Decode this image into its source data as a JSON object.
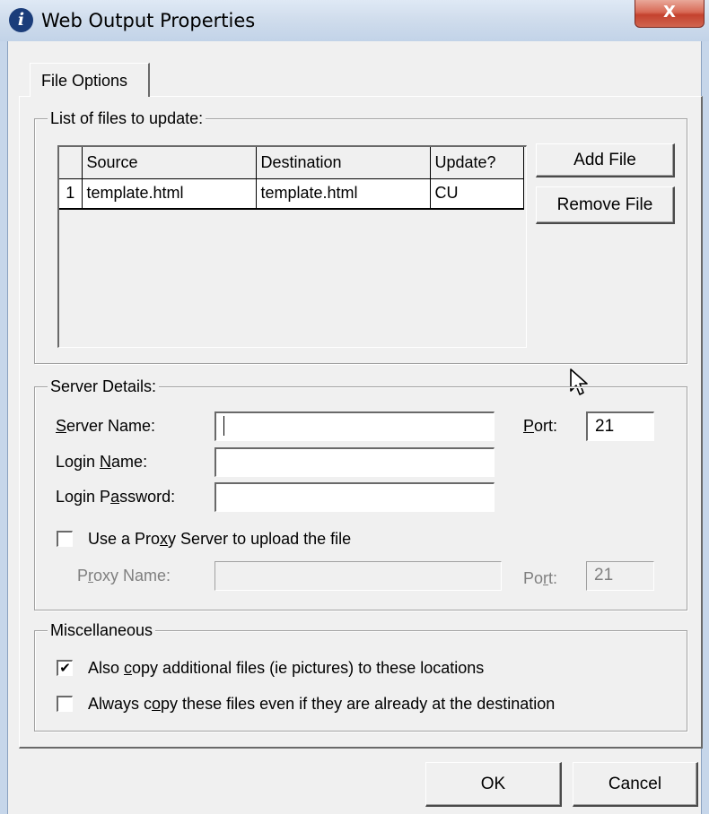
{
  "window": {
    "title": "Web Output Properties",
    "icon": "info-icon",
    "close_glyph": "X"
  },
  "tabs": [
    {
      "label": "File Options",
      "selected": true
    }
  ],
  "files_group": {
    "label": "List of files to update:",
    "columns": [
      "Source",
      "Destination",
      "Update?"
    ],
    "rows": [
      {
        "num": "1",
        "source": "template.html",
        "destination": "template.html",
        "update": "CU"
      }
    ],
    "add_button": "Add File",
    "remove_button": "Remove File"
  },
  "server_group": {
    "label": "Server Details:",
    "server_name": {
      "label_pre": "",
      "label_u": "S",
      "label_post": "erver Name:",
      "value": ""
    },
    "login_name": {
      "label_pre": "Login ",
      "label_u": "N",
      "label_post": "ame:",
      "value": ""
    },
    "login_password": {
      "label_pre": "Login P",
      "label_u": "a",
      "label_post": "ssword:",
      "value": ""
    },
    "port": {
      "label_pre": "",
      "label_u": "P",
      "label_post": "ort:",
      "value": "21"
    },
    "use_proxy": {
      "label_pre": "Use a Pro",
      "label_u": "x",
      "label_post": "y Server to upload the file",
      "checked": false
    },
    "proxy_name": {
      "label_pre": "P",
      "label_u": "r",
      "label_post": "oxy Name:",
      "value": ""
    },
    "proxy_port": {
      "label_pre": "Po",
      "label_u": "r",
      "label_post": "t:",
      "value": "21"
    }
  },
  "misc_group": {
    "label": "Miscellaneous",
    "copy_additional": {
      "label_pre": "Also ",
      "label_u": "c",
      "label_post": "opy additional files (ie pictures) to these locations",
      "checked": true,
      "mark": "✔"
    },
    "always_copy": {
      "label_pre": "Always c",
      "label_u": "o",
      "label_post": "py these files even if they are already at the destination",
      "checked": false
    }
  },
  "footer": {
    "ok": "OK",
    "cancel": "Cancel"
  }
}
